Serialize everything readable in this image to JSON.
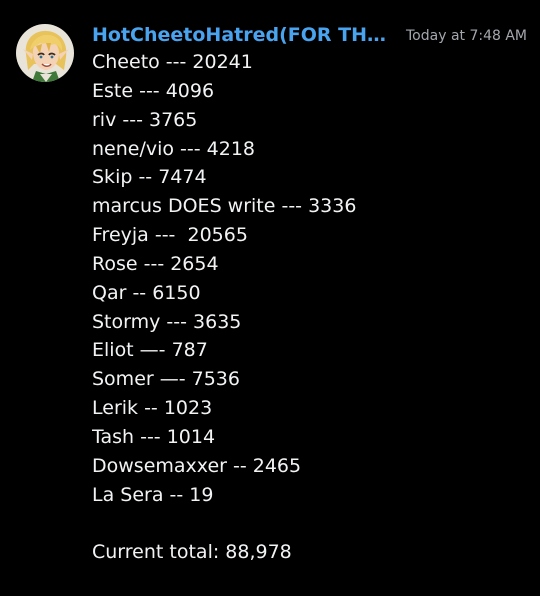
{
  "message": {
    "author": {
      "username": "HotCheetoHatred(FOR THE C...",
      "avatar_icon": "user-avatar-icon",
      "name_color": "#4aa3ee"
    },
    "timestamp": "Today at 7:48 AM",
    "lines": [
      "Cheeto --- 20241",
      "Este --- 4096",
      "riv --- 3765",
      "nene/vio --- 4218",
      "Skip -- 7474",
      "marcus DOES write --- 3336",
      "Freyja ---  20565",
      "Rose --- 2654",
      "Qar -- 6150",
      "Stormy --- 3635",
      "Eliot —- 787",
      "Somer —- 7536",
      "Lerik -- 1023",
      "Tash --- 1014",
      "Dowsemaxxer -- 2465",
      "La Sera -- 19"
    ],
    "total_line": "Current total: 88,978"
  },
  "colors": {
    "background": "#000000",
    "text": "#f2f3f5",
    "timestamp": "#a3a6ad"
  }
}
